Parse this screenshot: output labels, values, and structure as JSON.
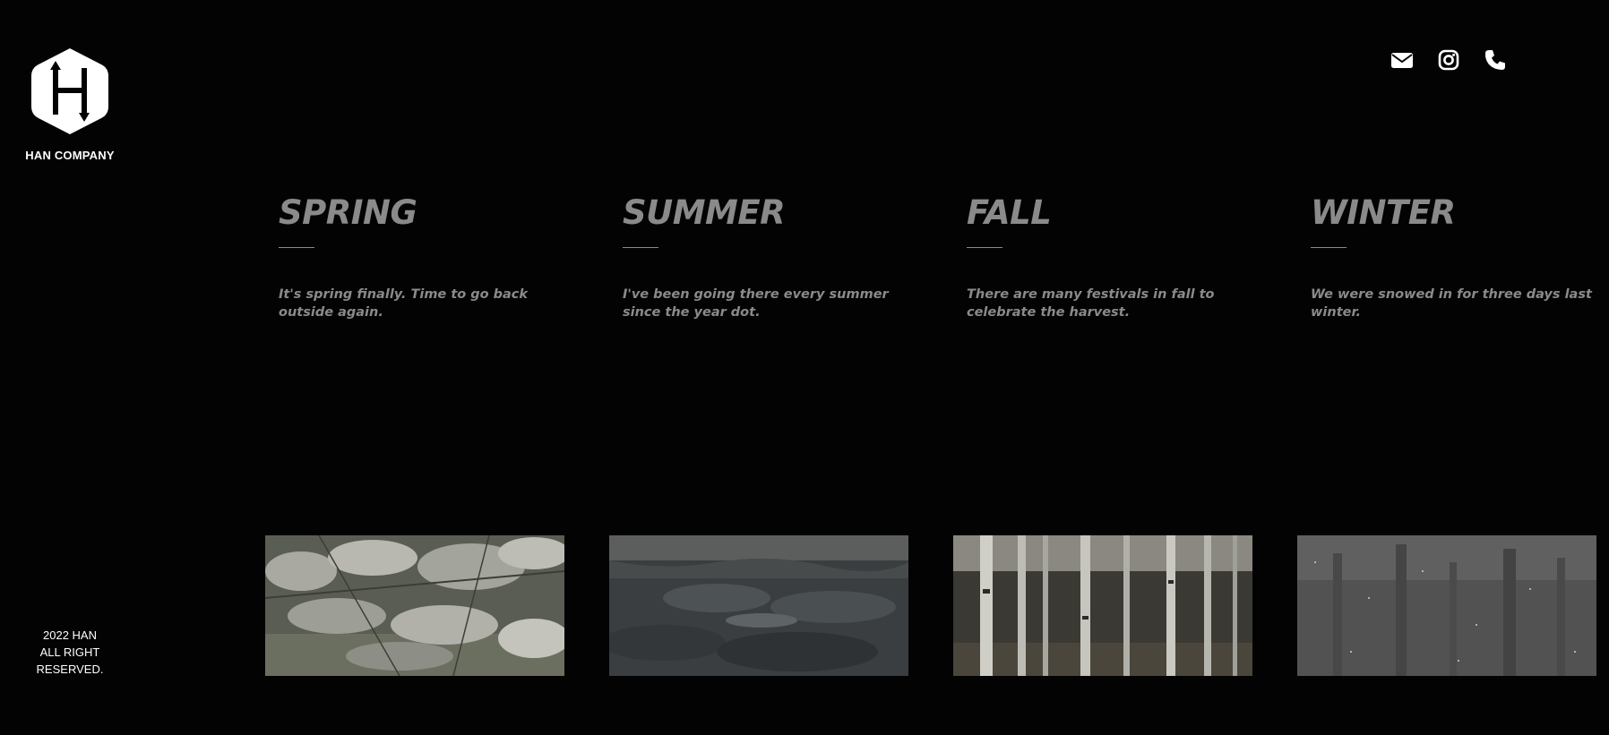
{
  "brand": {
    "name": "HAN COMPANY",
    "logo_letter": "H"
  },
  "footer": {
    "copyright_lines": [
      "2022 HAN",
      "ALL RIGHT",
      "RESERVED."
    ]
  },
  "contact": {
    "icons": [
      "envelope-icon",
      "instagram-icon",
      "phone-icon"
    ]
  },
  "seasons": [
    {
      "title": "SPRING",
      "text": "It's spring finally. Time to go back outside again."
    },
    {
      "title": "SUMMER",
      "text": "I've been going there every summer since the year dot."
    },
    {
      "title": "FALL",
      "text": "There are many festivals in fall to celebrate the harvest."
    },
    {
      "title": "WINTER",
      "text": "We were snowed in for three days last winter."
    }
  ],
  "colors": {
    "background": "#030303",
    "text_muted": "#8a8a8a",
    "white": "#ffffff"
  }
}
